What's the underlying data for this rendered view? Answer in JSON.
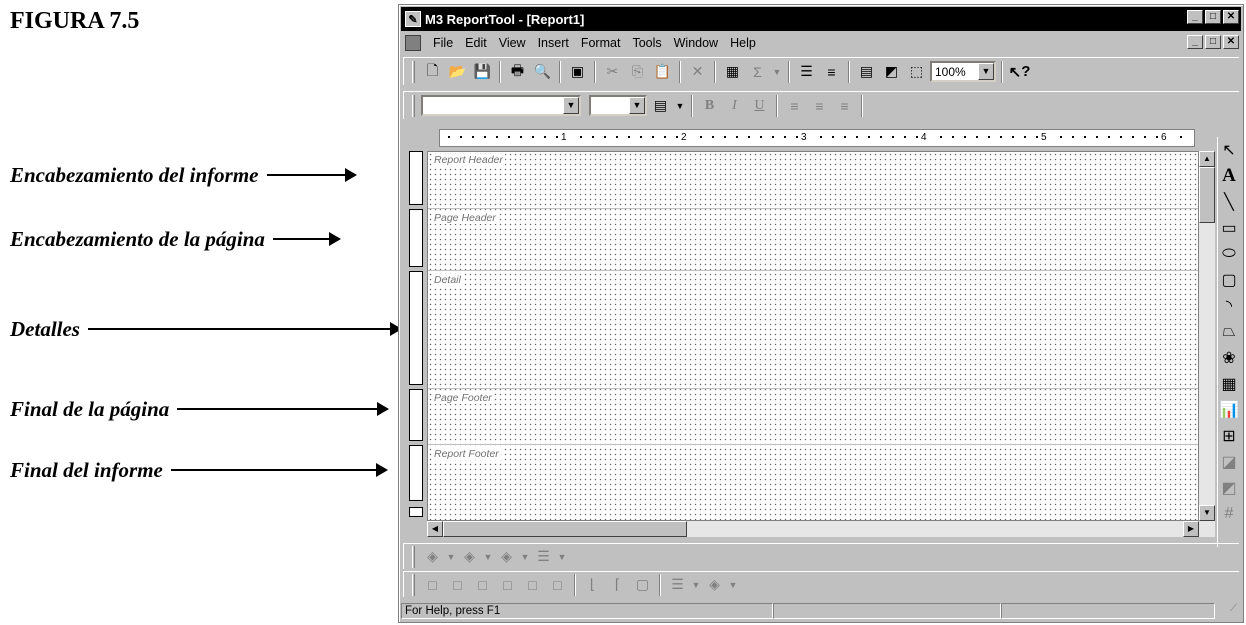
{
  "figure": {
    "caption": "FIGURA 7.5",
    "callouts": [
      "Encabezamiento del informe",
      "Encabezamiento de la página",
      "Detalles",
      "Final de la página",
      "Final del informe"
    ]
  },
  "window": {
    "title": "M3 ReportTool - [Report1]",
    "controls": [
      "_",
      "□",
      "✕"
    ]
  },
  "menubar": {
    "items": [
      "File",
      "Edit",
      "View",
      "Insert",
      "Format",
      "Tools",
      "Window",
      "Help"
    ]
  },
  "toolbar": {
    "zoom": "100%",
    "sum_glyph": "Σ",
    "help_glyph": "?"
  },
  "format_toolbar": {
    "font_value": "",
    "size_value": "",
    "bold": "B",
    "italic": "I",
    "underline": "U"
  },
  "ruler": {
    "labels": [
      "1",
      "2",
      "3",
      "4",
      "5",
      "6"
    ]
  },
  "bands": [
    {
      "name": "Report Header"
    },
    {
      "name": "Page Header"
    },
    {
      "name": "Detail"
    },
    {
      "name": "Page Footer"
    },
    {
      "name": "Report Footer"
    }
  ],
  "toolbox": {
    "tools": [
      "pointer-icon",
      "text-icon",
      "line-icon",
      "rectangle-icon",
      "ellipse-icon",
      "rounded-rect-icon",
      "arc-icon",
      "polygon-icon",
      "image-icon",
      "table-icon",
      "chart-icon",
      "subreport-icon",
      "bring-front-icon",
      "send-back-icon",
      "grid-icon"
    ]
  },
  "statusbar": {
    "message": "For Help, press F1"
  }
}
